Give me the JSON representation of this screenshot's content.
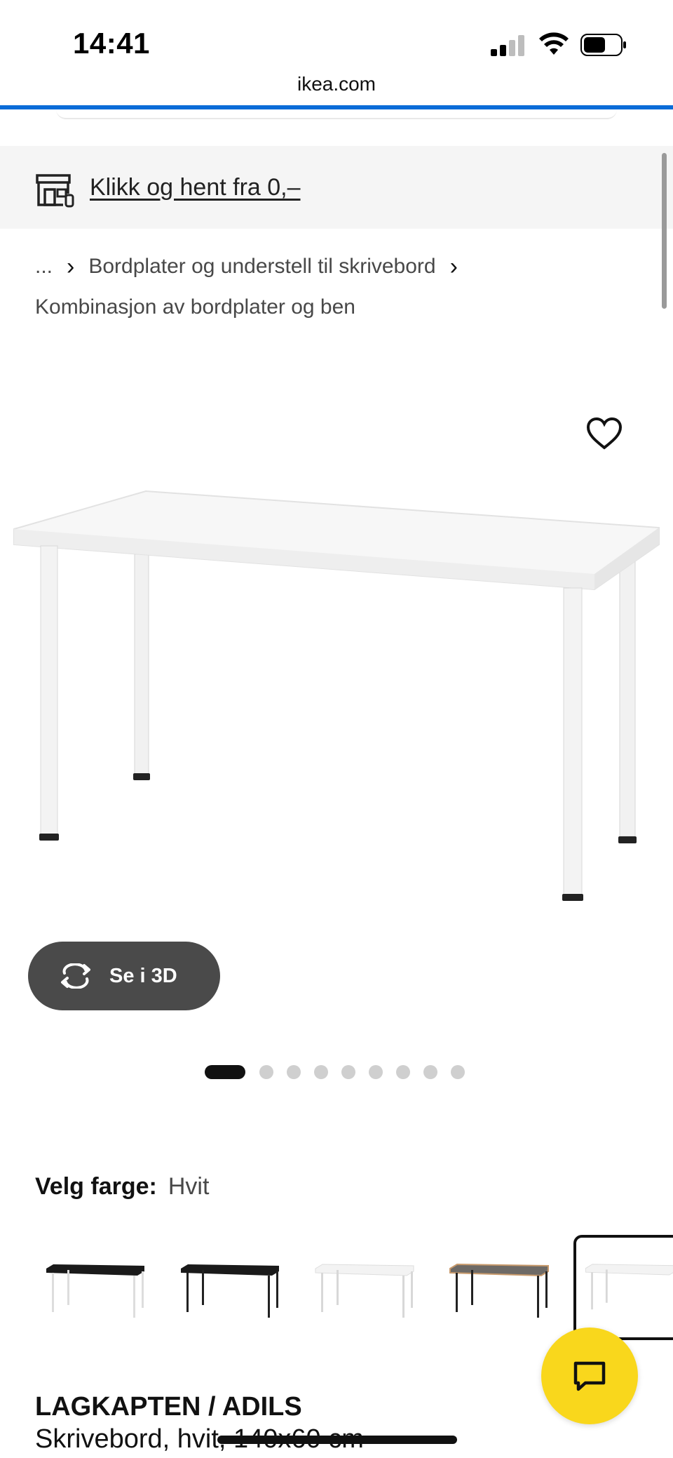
{
  "status": {
    "time": "14:41"
  },
  "browser": {
    "url": "ikea.com"
  },
  "banner": {
    "link_text": "Klikk og hent fra 0,–",
    "icon": "store-pickup-icon"
  },
  "breadcrumb": {
    "ellipsis": "...",
    "category": "Bordplater og understell til skrivebord",
    "current": "Kombinasjon av bordplater og ben"
  },
  "gallery": {
    "see_3d_label": "Se i 3D",
    "image_count": 9,
    "active_index": 0
  },
  "colour": {
    "label": "Velg farge:",
    "selected": "Hvit",
    "swatches": [
      {
        "top": "black",
        "legs": "white"
      },
      {
        "top": "black",
        "legs": "black"
      },
      {
        "top": "white",
        "legs": "white"
      },
      {
        "top": "grey-wood",
        "legs": "black"
      },
      {
        "top": "white",
        "legs": "white",
        "selected": true
      }
    ]
  },
  "product": {
    "name": "LAGKAPTEN / ADILS",
    "description": "Skrivebord, hvit, 140x60 cm"
  },
  "colors": {
    "accent_blue": "#0a6cd8",
    "chat_yellow": "#f9d71c",
    "dark_button": "#4a4a4a"
  }
}
